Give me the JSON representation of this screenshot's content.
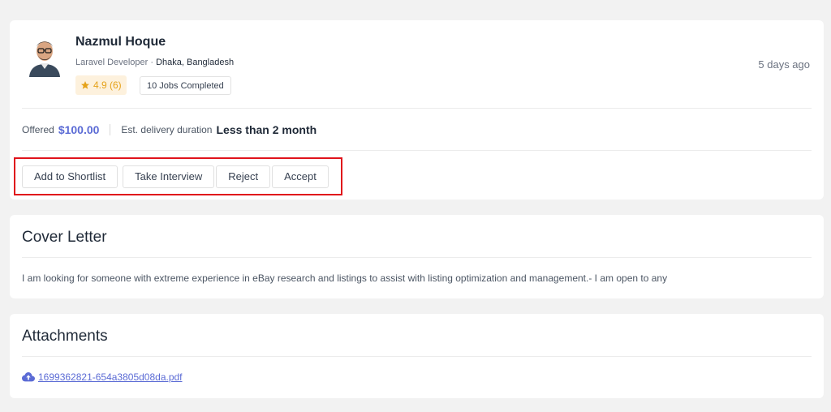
{
  "profile": {
    "name": "Nazmul Hoque",
    "role": "Laravel Developer",
    "separator": "·",
    "location": "Dhaka, Bangladesh",
    "rating": "4.9 (6)",
    "jobs_completed": "10 Jobs Completed",
    "posted": "5 days ago"
  },
  "offer": {
    "label": "Offered",
    "amount": "$100.00",
    "delivery_label": "Est. delivery duration",
    "delivery_value": "Less than 2 month"
  },
  "actions": {
    "shortlist": "Add to Shortlist",
    "interview": "Take Interview",
    "reject": "Reject",
    "accept": "Accept"
  },
  "cover_letter": {
    "title": "Cover Letter",
    "text": "I am looking for someone with extreme experience in eBay research and listings to assist with listing optimization and management.- I am open to any"
  },
  "attachments": {
    "title": "Attachments",
    "file": "1699362821-654a3805d08da.pdf",
    "icon": "cloud-upload-icon"
  },
  "colors": {
    "accent": "#5b6bd5",
    "star": "#e5a21a",
    "highlight_border": "#e0131b"
  }
}
